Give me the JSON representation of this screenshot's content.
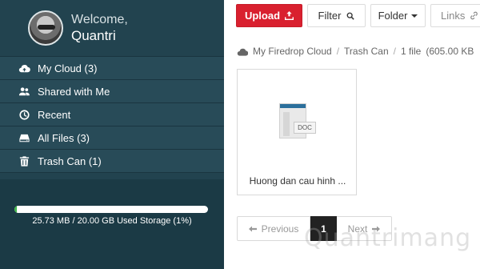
{
  "profile": {
    "welcome": "Welcome,",
    "username": "Quantri"
  },
  "nav": [
    {
      "icon": "cloud-upload-icon",
      "label": "My Cloud (3)"
    },
    {
      "icon": "users-icon",
      "label": "Shared with Me"
    },
    {
      "icon": "clock-icon",
      "label": "Recent"
    },
    {
      "icon": "drive-icon",
      "label": "All Files (3)"
    },
    {
      "icon": "trash-icon",
      "label": "Trash Can (1)"
    }
  ],
  "storage": {
    "used_fraction": 0.01,
    "text": "25.73 MB / 20.00 GB Used Storage (1%)"
  },
  "toolbar": {
    "upload": "Upload",
    "filter": "Filter",
    "folder": "Folder",
    "links": "Links"
  },
  "breadcrumb": {
    "root": "My Firedrop Cloud",
    "current": "Trash Can",
    "count": "1 file",
    "size": "(605.00 KB"
  },
  "file": {
    "type_tag": "DOC",
    "name": "Huong dan cau hinh ..."
  },
  "pager": {
    "prev": "Previous",
    "current": "1",
    "next": "Next"
  },
  "watermark": "Quantrimang",
  "colors": {
    "sidebar": "#22434f",
    "upload": "#d9202f",
    "storage_fill": "#3fb44a"
  }
}
